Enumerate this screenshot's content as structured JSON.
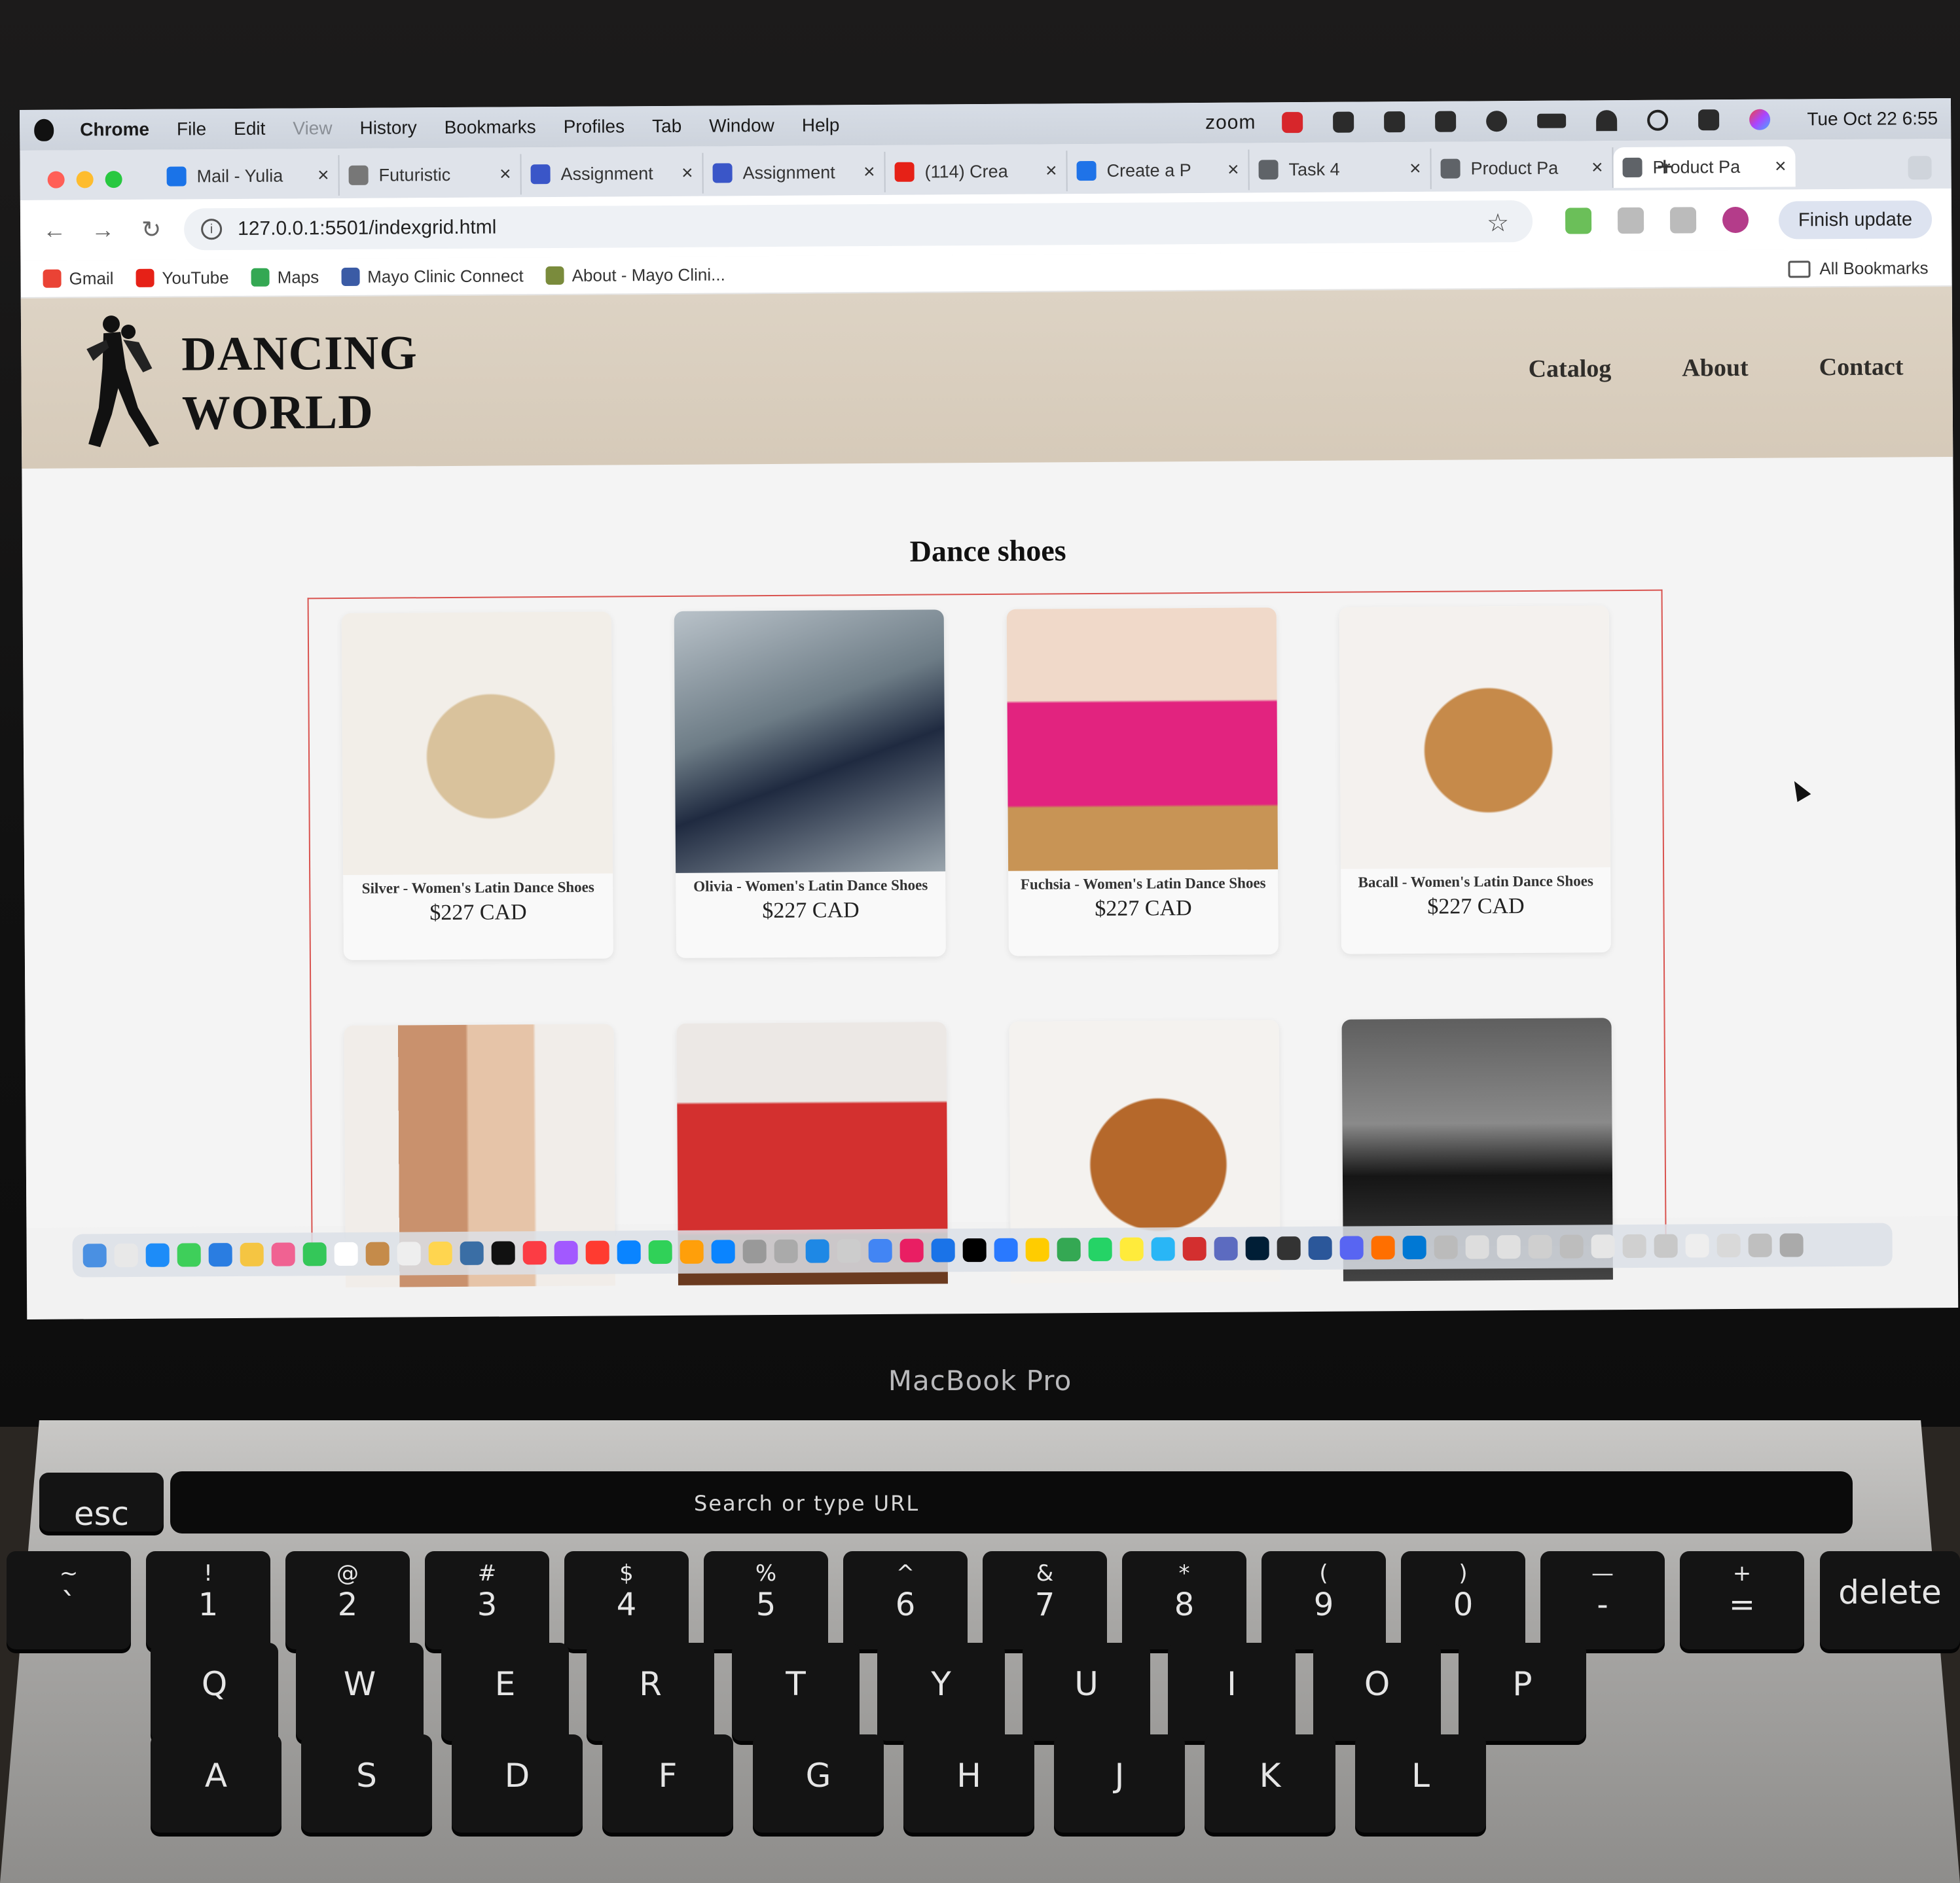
{
  "menubar": {
    "app": "Chrome",
    "items": [
      "File",
      "Edit",
      "View",
      "History",
      "Bookmarks",
      "Profiles",
      "Tab",
      "Window",
      "Help"
    ],
    "zoom_label": "zoom",
    "clock": "Tue Oct 22  6:55"
  },
  "tabs": [
    {
      "title": "Mail - Yulia",
      "color": "#1a73e8"
    },
    {
      "title": "Futuristic",
      "color": "#777777"
    },
    {
      "title": "Assignment",
      "color": "#3a56c8"
    },
    {
      "title": "Assignment",
      "color": "#3a56c8"
    },
    {
      "title": "(114) Crea",
      "color": "#e62117"
    },
    {
      "title": "Create a P",
      "color": "#1f73e8"
    },
    {
      "title": "Task 4",
      "color": "#5f6368"
    },
    {
      "title": "Product Pa",
      "color": "#5f6368"
    },
    {
      "title": "Product Pa",
      "color": "#5f6368",
      "active": true
    }
  ],
  "toolbar": {
    "url": "127.0.0.1:5501/indexgrid.html",
    "finish_update": "Finish update"
  },
  "bookmarks": [
    {
      "label": "Gmail",
      "color": "#ea4335"
    },
    {
      "label": "YouTube",
      "color": "#e62117"
    },
    {
      "label": "Maps",
      "color": "#34a853"
    },
    {
      "label": "Mayo Clinic Connect",
      "color": "#3b5ba5"
    },
    {
      "label": "About - Mayo Clini...",
      "color": "#7a8b3c"
    }
  ],
  "all_bookmarks": "All Bookmarks",
  "site": {
    "brand_line1": "DANCING",
    "brand_line2": "WORLD",
    "nav": [
      "Catalog",
      "About",
      "Contact"
    ],
    "page_title": "Dance shoes"
  },
  "products": [
    {
      "name": "Silver - Women's Latin Dance Shoes",
      "price": "$227 CAD"
    },
    {
      "name": "Olivia - Women's Latin Dance Shoes",
      "price": "$227 CAD"
    },
    {
      "name": "Fuchsia - Women's Latin Dance Shoes",
      "price": "$227 CAD"
    },
    {
      "name": "Bacall - Women's Latin Dance Shoes",
      "price": "$227 CAD"
    },
    {
      "name": "",
      "price": ""
    },
    {
      "name": "",
      "price": ""
    },
    {
      "name": "",
      "price": ""
    },
    {
      "name": "",
      "price": ""
    }
  ],
  "device": {
    "label": "MacBook Pro",
    "touchbar_url": "Search or type URL"
  },
  "keys_row1": [
    {
      "top": "~",
      "bot": "`"
    },
    {
      "top": "!",
      "bot": "1"
    },
    {
      "top": "@",
      "bot": "2"
    },
    {
      "top": "#",
      "bot": "3"
    },
    {
      "top": "$",
      "bot": "4"
    },
    {
      "top": "%",
      "bot": "5"
    },
    {
      "top": "^",
      "bot": "6"
    },
    {
      "top": "&",
      "bot": "7"
    },
    {
      "top": "*",
      "bot": "8"
    },
    {
      "top": "(",
      "bot": "9"
    },
    {
      "top": ")",
      "bot": "0"
    },
    {
      "top": "—",
      "bot": "-"
    },
    {
      "top": "+",
      "bot": "="
    }
  ],
  "keys_row2": [
    "Q",
    "W",
    "E",
    "R",
    "T",
    "Y",
    "U",
    "I",
    "O",
    "P"
  ],
  "keys_row3": [
    "A",
    "S",
    "D",
    "F",
    "G",
    "H",
    "J",
    "K",
    "L"
  ],
  "esc_label": "esc",
  "delete_label": "delete"
}
